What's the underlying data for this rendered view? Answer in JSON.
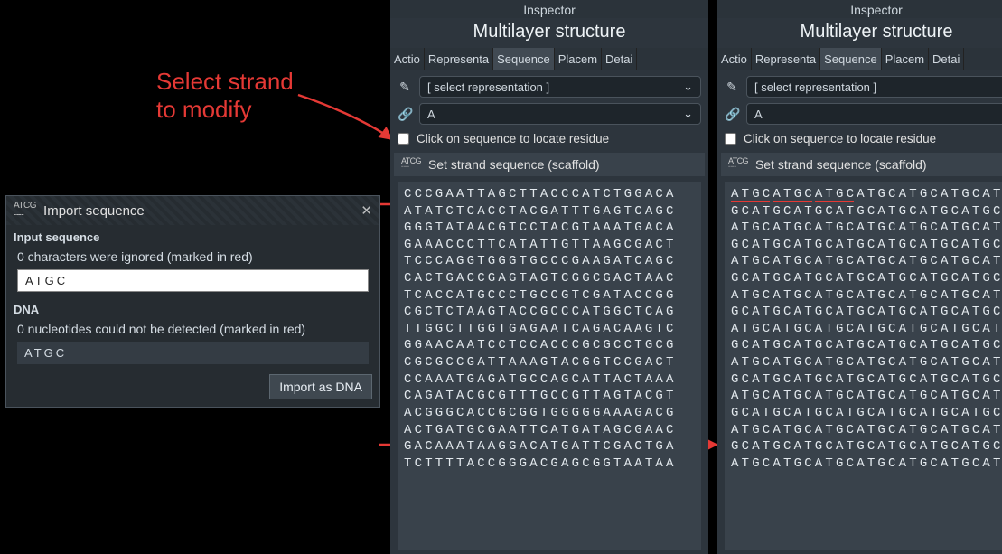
{
  "annotation": {
    "line1": "Select strand",
    "line2": "to modify"
  },
  "importDialog": {
    "title": "Import sequence",
    "section_input": "Input sequence",
    "ignored_msg": "0 characters were ignored (marked in red)",
    "input_value": "ATGC",
    "section_dna": "DNA",
    "undetected_msg": "0 nucleotides could not be detected (marked in red)",
    "dna_value": "ATGC",
    "import_btn": "Import as DNA"
  },
  "inspector": {
    "title": "Inspector",
    "heading": "Multilayer structure",
    "tabs": {
      "actio": "Actio",
      "representa": "Representa",
      "sequence": "Sequence",
      "placem": "Placem",
      "detai": "Detai"
    },
    "select_repr": "[ select representation ]",
    "select_chain": "A",
    "locate_checkbox": "Click on sequence to locate residue",
    "set_strand_btn": "Set strand sequence (scaffold)"
  },
  "sequences": {
    "scaffold": "CCCGAATTAGCTTACCCATCTGGACA\nATATCTCACCTACGATTTGAGTCAGC\nGGGTATAACGTCCTACGTAAATGACA\nGAAACCCTTCATATTGTTAAGCGACT\nTCCCAGGTGGGTGCCCGAAGATCAGC\nCACTGACCGAGTAGTCGGCGACTAAC\nTCACCATGCCCTGCCGTCGATACCGG\nCGCTCTAAGTACCGCCCATGGCTCAG\nTTGGCTTGGTGAGAATCAGACAAGTC\nGGAACAATCCTCCACCCGCGCCTGCG\nCGCGCCGATTAAAGTACGGTCCGACT\nCCAAATGAGATGCCAGCATTACTAAA\nCAGATACGCGTTTGCCGTTAGTACGT\nACGGGCACCGCGGTGGGGGAAAGACG\nACTGATGCGAATTCATGATAGCGAAC\nGACAAATAAGGACATGATTCGACTGA\nTCTTTTACCGGGACGAGCGGTAATAA",
    "repeated": "ATGCATGCATGCATGCATGCATGCAT\nGCATGCATGCATGCATGCATGCATGC\nATGCATGCATGCATGCATGCATGCAT\nGCATGCATGCATGCATGCATGCATGC\nATGCATGCATGCATGCATGCATGCAT\nGCATGCATGCATGCATGCATGCATGC\nATGCATGCATGCATGCATGCATGCAT\nGCATGCATGCATGCATGCATGCATGC\nATGCATGCATGCATGCATGCATGCAT\nGCATGCATGCATGCATGCATGCATGC\nATGCATGCATGCATGCATGCATGCAT\nGCATGCATGCATGCATGCATGCATGC\nATGCATGCATGCATGCATGCATGCAT\nGCATGCATGCATGCATGCATGCATGC\nATGCATGCATGCATGCATGCATGCAT\nGCATGCATGCATGCATGCATGCATGC\nATGCATGCATGCATGCATGCATGCAT"
  }
}
